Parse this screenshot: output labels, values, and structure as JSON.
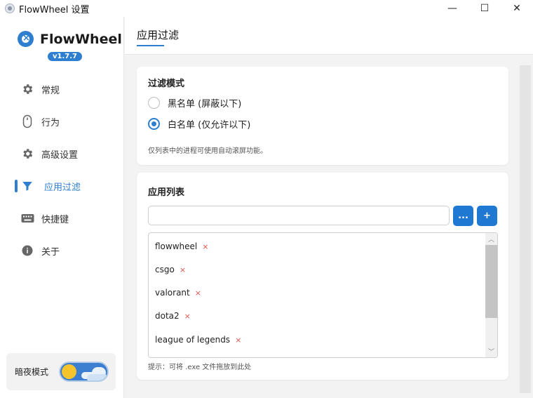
{
  "window": {
    "title": "FlowWheel 设置",
    "minimize": "—",
    "maximize": "☐",
    "close": "✕"
  },
  "brand": {
    "name": "FlowWheel",
    "version": "v1.7.7"
  },
  "nav": {
    "items": [
      {
        "label": "常规",
        "icon": "gear-icon"
      },
      {
        "label": "行为",
        "icon": "mouse-icon"
      },
      {
        "label": "高级设置",
        "icon": "gear-icon"
      },
      {
        "label": "应用过滤",
        "icon": "filter-icon",
        "active": true
      },
      {
        "label": "快捷键",
        "icon": "keyboard-icon"
      },
      {
        "label": "关于",
        "icon": "info-icon"
      }
    ]
  },
  "night_mode": {
    "label": "暗夜模式",
    "enabled": false
  },
  "header": {
    "title": "应用过滤"
  },
  "filter_mode": {
    "title": "过滤模式",
    "options": [
      {
        "label": "黑名单 (屏蔽以下)",
        "checked": false
      },
      {
        "label": "白名单 (仅允许以下)",
        "checked": true
      }
    ],
    "hint": "仅列表中的进程可使用自动滚屏功能。"
  },
  "app_list": {
    "title": "应用列表",
    "input_value": "",
    "browse_label": "...",
    "add_label": "+",
    "remove_symbol": "×",
    "items": [
      "flowwheel",
      "csgo",
      "valorant",
      "dota2",
      "league of legends"
    ],
    "hint": "提示：可将 .exe 文件拖放到此处"
  },
  "colors": {
    "accent": "#2f7fd1",
    "remove": "#d9534f",
    "toggle_knob": "#f5c42c"
  }
}
